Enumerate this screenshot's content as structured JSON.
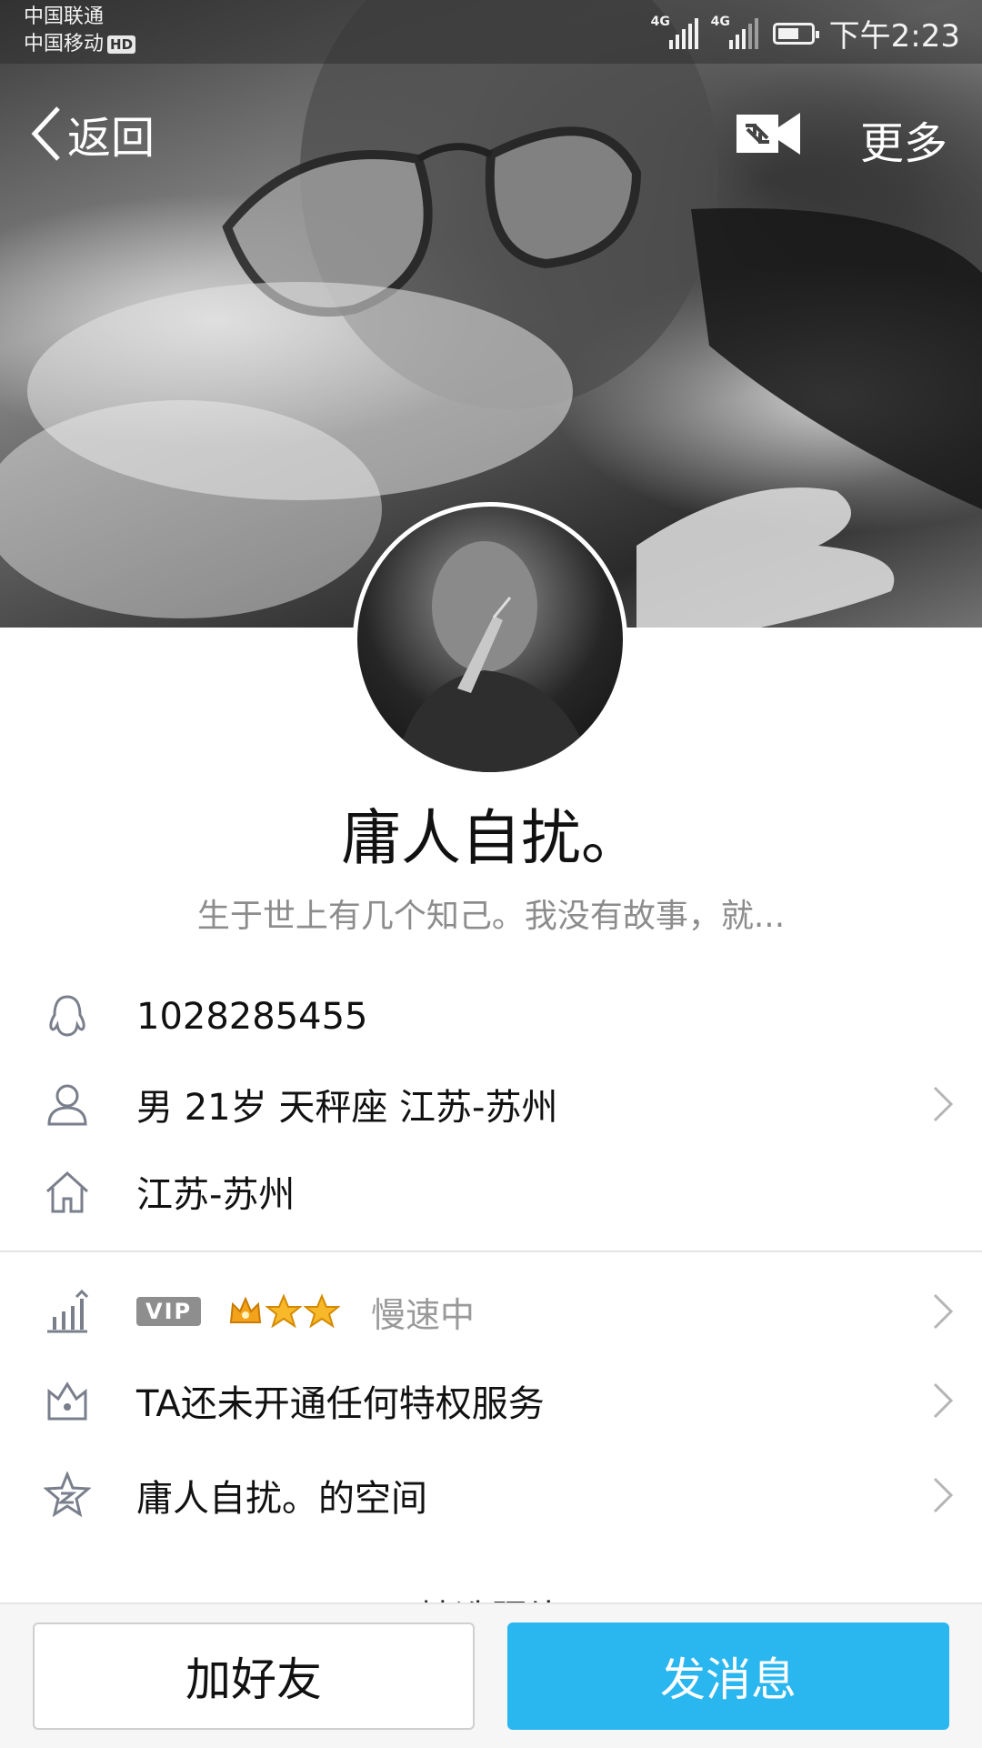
{
  "status_bar": {
    "carrier_1": "中国联通",
    "carrier_2": "中国移动",
    "hd_badge": "HD",
    "network_1": "4G",
    "network_2": "4G",
    "time": "下午2:23"
  },
  "nav": {
    "back_label": "返回",
    "more_label": "更多",
    "video_icon": "video-call-icon"
  },
  "profile": {
    "nickname": "庸人自扰。",
    "signature": "生于世上有几个知己。我没有故事，就...",
    "qq_number": "1028285455",
    "basic_info": "男  21岁  天秤座  江苏-苏州",
    "hometown": "江苏-苏州"
  },
  "services": {
    "vip_badge": "VIP",
    "vip_status": "慢速中",
    "privilege_text": "TA还未开通任何特权服务",
    "space_text": "庸人自扰。的空间",
    "peek_text": "精选照片"
  },
  "actions": {
    "add_friend": "加好友",
    "send_message": "发消息"
  },
  "colors": {
    "accent": "#2ab6ef",
    "icon_gray": "#7a7f8c",
    "vip_gray": "#8e8e8e"
  }
}
